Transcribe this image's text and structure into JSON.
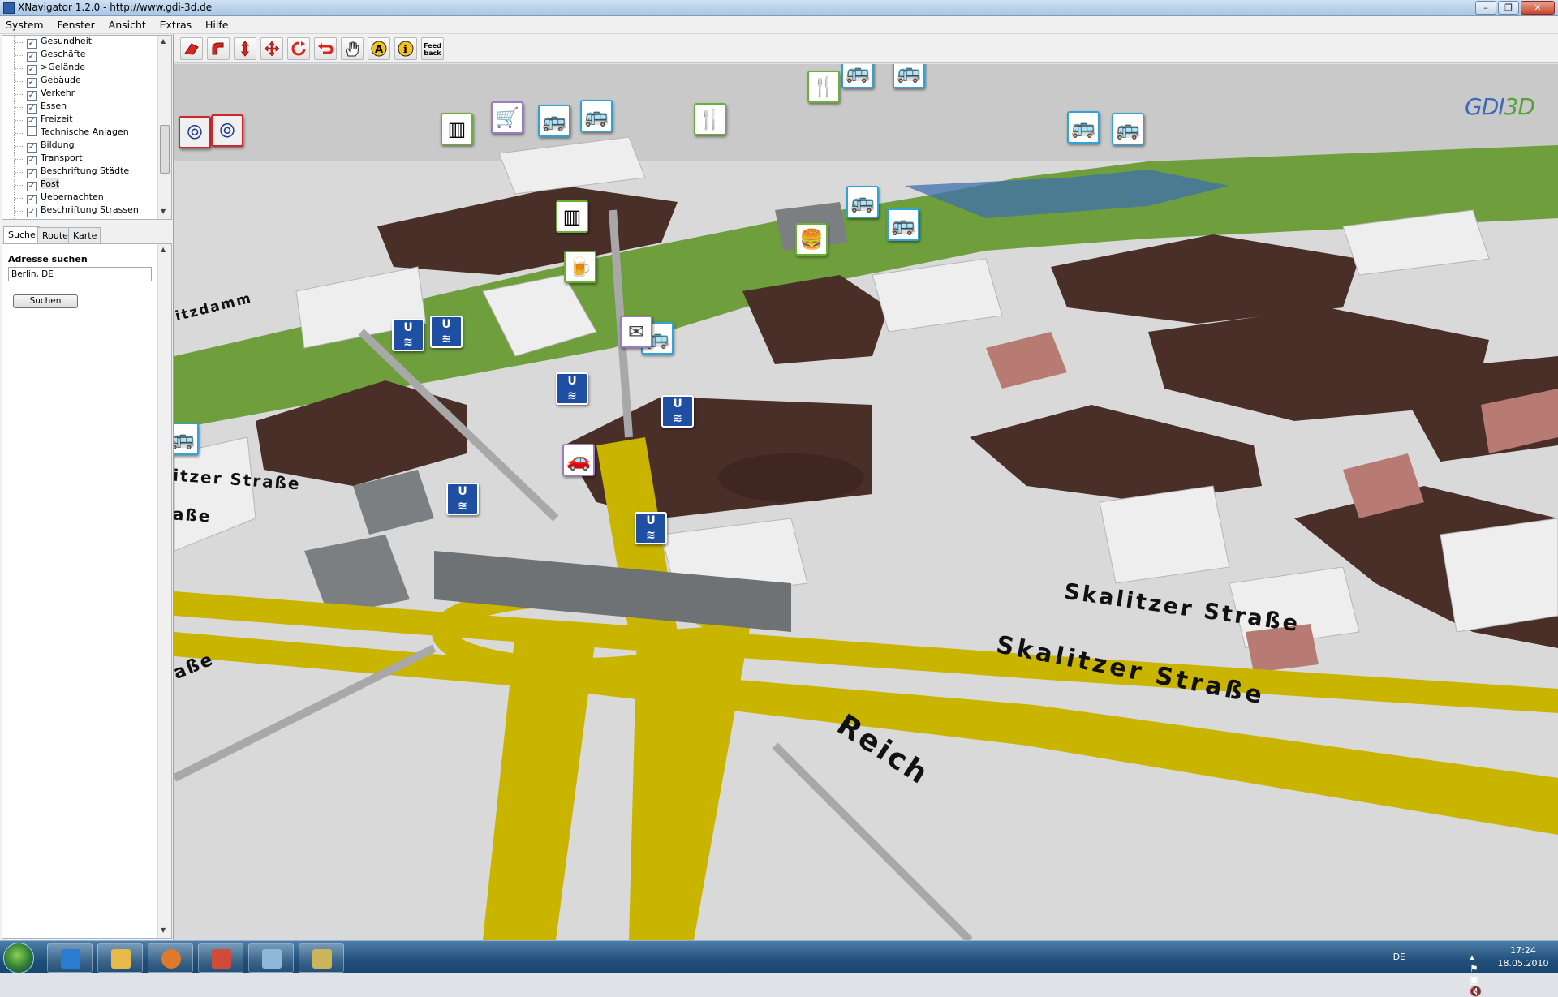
{
  "window": {
    "title": "XNavigator 1.2.0 - http://www.gdi-3d.de",
    "controls": [
      "–",
      "❐",
      "✕"
    ]
  },
  "menu": [
    "System",
    "Fenster",
    "Ansicht",
    "Extras",
    "Hilfe"
  ],
  "layers": [
    {
      "label": "Gesundheit",
      "checked": true
    },
    {
      "label": "Geschäfte",
      "checked": true
    },
    {
      "label": ">Gelände",
      "checked": true
    },
    {
      "label": "Gebäude",
      "checked": true
    },
    {
      "label": "Verkehr",
      "checked": true
    },
    {
      "label": "Essen",
      "checked": true
    },
    {
      "label": "Freizeit",
      "checked": true
    },
    {
      "label": "Technische Anlagen",
      "checked": false
    },
    {
      "label": "Bildung",
      "checked": true
    },
    {
      "label": "Transport",
      "checked": true
    },
    {
      "label": "Beschriftung Städte",
      "checked": true
    },
    {
      "label": "Post",
      "checked": true,
      "selected": true
    },
    {
      "label": "Uebernachten",
      "checked": true
    },
    {
      "label": "Beschriftung Strassen",
      "checked": true
    }
  ],
  "tabs": [
    "Suche",
    "Route",
    "Karte"
  ],
  "search": {
    "heading": "Adresse suchen",
    "value": "Berlin, DE",
    "button": "Suchen"
  },
  "toolbar": {
    "tools": [
      "pan-tool-icon",
      "rotate-tool-icon",
      "move-ns-icon",
      "move-all-icon",
      "orbit-icon",
      "undo-icon",
      "hand-icon",
      "label-icon",
      "info-icon"
    ],
    "feedback_label": "Feed back"
  },
  "map": {
    "logo_main": "GDI",
    "logo_accent": "3D",
    "streets": {
      "skalitzer_1": "Skalitzer Straße",
      "skalitzer_2": "Skalitzer Straße",
      "reich": "Reich",
      "left_1": "itzer Straße",
      "left_2": "aße",
      "bottom_left": "aße",
      "damm": "itzdamm"
    },
    "poi_icons": [
      "ubahn-icon",
      "bus-icon",
      "shop-icon",
      "food-icon",
      "post-icon",
      "hotel-icon"
    ]
  },
  "taskbar": {
    "lang": "DE",
    "time": "17:24",
    "date": "18.05.2010"
  },
  "colors": {
    "road_yellow": "#c9b400",
    "building_dark": "#4a2e28",
    "building_light": "#e8e8e8",
    "ubahn_blue": "#1f4fa3"
  }
}
